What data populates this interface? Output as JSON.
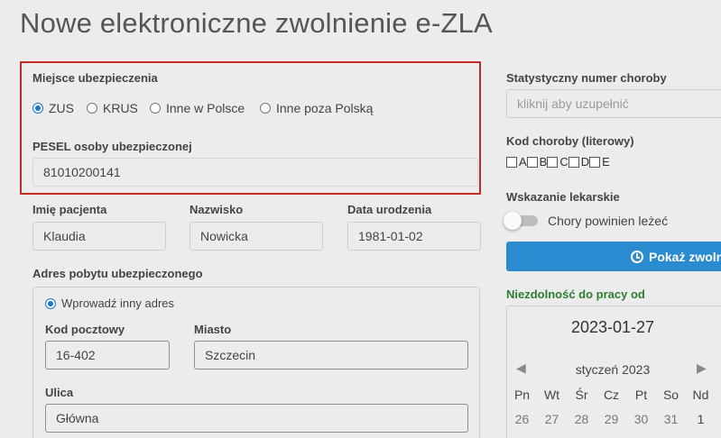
{
  "page": {
    "title": "Nowe elektroniczne zwolnienie e-ZLA"
  },
  "insurance": {
    "label": "Miejsce ubezpieczenia",
    "options": [
      "ZUS",
      "KRUS",
      "Inne w Polsce",
      "Inne poza Polską"
    ],
    "selected": "ZUS"
  },
  "pesel": {
    "label": "PESEL osoby ubezpieczonej",
    "value": "81010200141"
  },
  "patient": {
    "first_name_label": "Imię pacjenta",
    "first_name": "Klaudia",
    "last_name_label": "Nazwisko",
    "last_name": "Nowicka",
    "birth_label": "Data urodzenia",
    "birth_date": "1981-01-02"
  },
  "address": {
    "label": "Adres pobytu ubezpieczonego",
    "other_option": "Wprowadź inny adres",
    "postal_label": "Kod pocztowy",
    "postal": "16-402",
    "city_label": "Miasto",
    "city": "Szczecin",
    "street_label": "Ulica",
    "street": "Główna"
  },
  "right": {
    "stat_label": "Statystyczny numer choroby",
    "stat_placeholder": "kliknij aby uzupełnić",
    "code_label": "Kod choroby (literowy)",
    "letters": [
      "A",
      "B",
      "C",
      "D",
      "E"
    ],
    "indication_label": "Wskazanie lekarskie",
    "toggle_label": "Chory powinien leżeć",
    "button_label": "Pokaż zwolni",
    "incapacity_label": "Niezdolność do pracy od"
  },
  "calendar": {
    "selected_date": "2023-01-27",
    "month": "styczeń 2023",
    "weekdays": [
      "Pn",
      "Wt",
      "Śr",
      "Cz",
      "Pt",
      "So",
      "Nd"
    ],
    "first_week": [
      "26",
      "27",
      "28",
      "29",
      "30",
      "31",
      "1"
    ]
  },
  "colors": {
    "accent": "#1976d2",
    "button": "#2a8bd0",
    "highlight": "#c62828",
    "green": "#2e7d32"
  }
}
